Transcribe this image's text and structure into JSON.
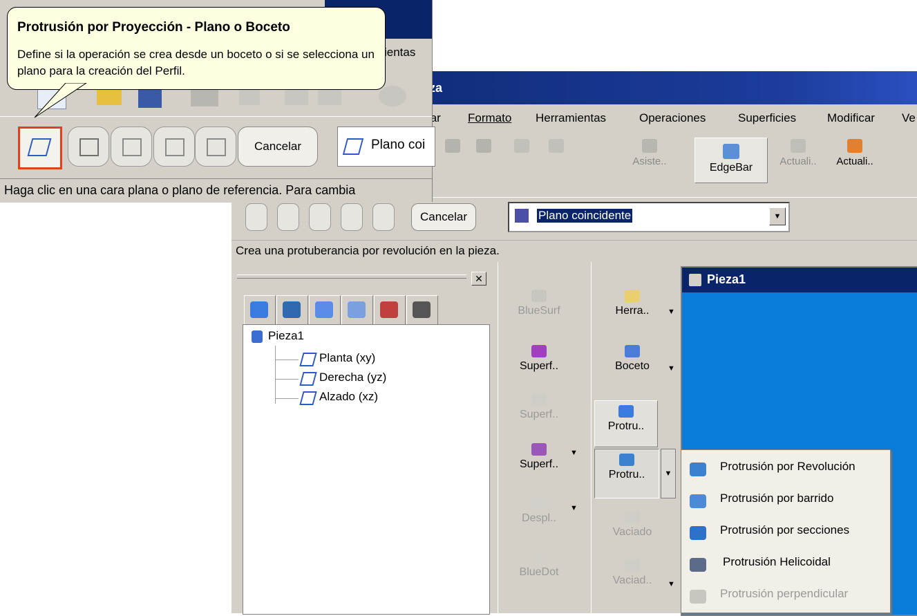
{
  "tooltip": {
    "title": "Protrusión por Proyección - Plano o Boceto",
    "body": "Define si la operación se crea desde un boceto o si se selecciona un plano para la creación del Perfil."
  },
  "left_window": {
    "menu_fragment": "ientas",
    "cancel_label": "Cancelar",
    "plane_value": "Plano coi",
    "status_text": "Haga clic en una cara plana o plano de referencia. Para cambia"
  },
  "main_window": {
    "title_fragment": "za",
    "menu": [
      "tar",
      "Formato",
      "Herramientas",
      "Operaciones",
      "Superficies",
      "Modificar",
      "Ve"
    ],
    "toolbar": {
      "asiste": "Asiste..",
      "edgebar": "EdgeBar",
      "actuali_1": "Actuali..",
      "actuali_2": "Actuali.."
    },
    "ribbon": {
      "cancel_label": "Cancelar",
      "plane_value": "Plano coincidente"
    },
    "status_text": "Crea una protuberancia por revolución en la pieza."
  },
  "tree": {
    "root": "Pieza1",
    "items": [
      "Planta (xy)",
      "Derecha (yz)",
      "Alzado (xz)"
    ]
  },
  "tools_col1": {
    "items": [
      "BlueSurf",
      "Superf..",
      "Superf..",
      "Superf..",
      "Despl..",
      "BlueDot"
    ]
  },
  "tools_col2": {
    "items": [
      "Herra..",
      "Boceto",
      "Protru..",
      "Protru..",
      "Vaciado",
      "Vaciad.."
    ]
  },
  "document_window": {
    "title": "Pieza1"
  },
  "flyout": {
    "items": [
      "Protrusión por Revolución",
      "Protrusión por barrido",
      "Protrusión por secciones",
      "Protrusión Helicoidal",
      "Protrusión perpendicular"
    ]
  }
}
